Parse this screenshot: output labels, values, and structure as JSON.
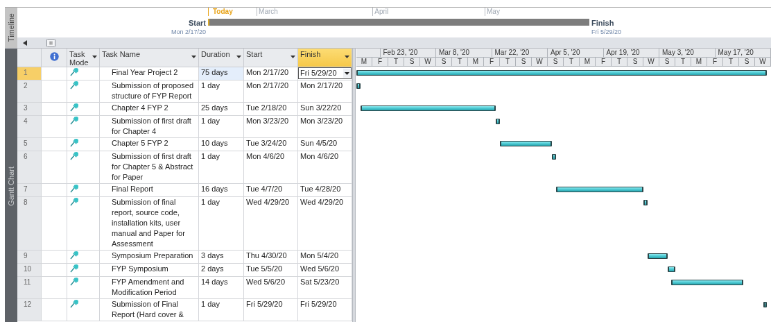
{
  "timeline": {
    "tab_label": "Timeline",
    "today_label": "Today",
    "months": [
      "March",
      "April",
      "May"
    ],
    "start_label": "Start",
    "start_date": "Mon 2/17/20",
    "finish_label": "Finish",
    "finish_date": "Fri 5/29/20"
  },
  "view": {
    "tab_label": "Gantt Chart"
  },
  "columns": [
    {
      "label": "Task Mode",
      "selected": false
    },
    {
      "label": "Task Name",
      "selected": false
    },
    {
      "label": "Duration",
      "selected": false
    },
    {
      "label": "Start",
      "selected": false
    },
    {
      "label": "Finish",
      "selected": true
    }
  ],
  "gantt": {
    "top_tier": [
      "Feb 23, '20",
      "Mar 8, '20",
      "Mar 22, '20",
      "Apr 5, '20",
      "Apr 19, '20",
      "May 3, '20",
      "May 17, '20"
    ],
    "bottom_tier": [
      "M",
      "F",
      "T",
      "S",
      "W",
      "S",
      "T",
      "M",
      "F",
      "T",
      "S",
      "W",
      "S",
      "T",
      "M",
      "F",
      "T",
      "S",
      "W",
      "S",
      "T",
      "M",
      "F",
      "T",
      "S",
      "W"
    ]
  },
  "rows": [
    {
      "id": "1",
      "name": "Final Year Project 2",
      "duration": "75 days",
      "start": "Mon 2/17/20",
      "finish": "Fri 5/29/20",
      "selected": true
    },
    {
      "id": "2",
      "name": "Submission of proposed structure of FYP Report",
      "duration": "1 day",
      "start": "Mon 2/17/20",
      "finish": "Mon 2/17/20",
      "selected": false
    },
    {
      "id": "3",
      "name": "Chapter 4 FYP 2",
      "duration": "25 days",
      "start": "Tue 2/18/20",
      "finish": "Sun 3/22/20",
      "selected": false
    },
    {
      "id": "4",
      "name": "Submission of first draft for Chapter 4",
      "duration": "1 day",
      "start": "Mon 3/23/20",
      "finish": "Mon 3/23/20",
      "selected": false
    },
    {
      "id": "5",
      "name": "Chapter 5 FYP 2",
      "duration": "10 days",
      "start": "Tue 3/24/20",
      "finish": "Sun 4/5/20",
      "selected": false
    },
    {
      "id": "6",
      "name": "Submission of first draft for Chapter 5 & Abstract for Paper",
      "duration": "1 day",
      "start": "Mon 4/6/20",
      "finish": "Mon 4/6/20",
      "selected": false
    },
    {
      "id": "7",
      "name": "Final Report",
      "duration": "16 days",
      "start": "Tue 4/7/20",
      "finish": "Tue 4/28/20",
      "selected": false
    },
    {
      "id": "8",
      "name": "Submission of final report, source code, installation kits, user manual and Paper for Assessment",
      "duration": "1 day",
      "start": "Wed 4/29/20",
      "finish": "Wed 4/29/20",
      "selected": false
    },
    {
      "id": "9",
      "name": "Symposium Preparation",
      "duration": "3 days",
      "start": "Thu 4/30/20",
      "finish": "Mon 5/4/20",
      "selected": false
    },
    {
      "id": "10",
      "name": "FYP Symposium",
      "duration": "2 days",
      "start": "Tue 5/5/20",
      "finish": "Wed 5/6/20",
      "selected": false
    },
    {
      "id": "11",
      "name": "FYP Amendment and Modification Period",
      "duration": "14 days",
      "start": "Wed 5/6/20",
      "finish": "Sat 5/23/20",
      "selected": false
    },
    {
      "id": "12",
      "name": "Submission of Final Report (Hard cover &",
      "duration": "1 day",
      "start": "Fri 5/29/20",
      "finish": "Fri 5/29/20",
      "selected": false
    }
  ]
}
